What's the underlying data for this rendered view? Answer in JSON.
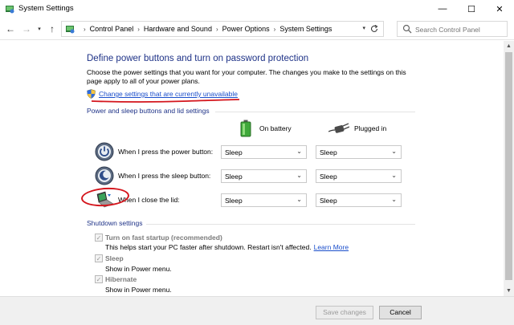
{
  "window": {
    "title": "System Settings",
    "minimize_glyph": "—",
    "maximize_glyph": "☐",
    "close_glyph": "✕"
  },
  "navigation": {
    "back_glyph": "←",
    "forward_glyph": "→",
    "history_glyph": "▾",
    "up_glyph": "↑",
    "breadcrumbs": [
      "Control Panel",
      "Hardware and Sound",
      "Power Options",
      "System Settings"
    ],
    "separator": "›",
    "search_placeholder": "Search Control Panel"
  },
  "main": {
    "heading": "Define power buttons and turn on password protection",
    "description": "Choose the power settings that you want for your computer. The changes you make to the settings on this page apply to all of your power plans.",
    "change_settings_link": "Change settings that are currently unavailable",
    "buttons_section": {
      "label": "Power and sleep buttons and lid settings",
      "on_battery": "On battery",
      "plugged_in": "Plugged in",
      "rows": [
        {
          "label": "When I press the power button:",
          "on_battery": "Sleep",
          "plugged_in": "Sleep",
          "icon": "power-button-icon"
        },
        {
          "label": "When I press the sleep button:",
          "on_battery": "Sleep",
          "plugged_in": "Sleep",
          "icon": "sleep-button-icon"
        },
        {
          "label": "When I close the lid:",
          "on_battery": "Sleep",
          "plugged_in": "Sleep",
          "icon": "laptop-lid-icon"
        }
      ]
    },
    "shutdown_section": {
      "label": "Shutdown settings",
      "options": [
        {
          "label": "Turn on fast startup (recommended)",
          "checked": true,
          "description": "This helps start your PC faster after shutdown. Restart isn't affected.",
          "link": "Learn More"
        },
        {
          "label": "Sleep",
          "checked": true,
          "description": "Show in Power menu."
        },
        {
          "label": "Hibernate",
          "checked": true,
          "description": "Show in Power menu."
        }
      ]
    }
  },
  "footer": {
    "save_label": "Save changes",
    "cancel_label": "Cancel"
  },
  "colors": {
    "heading": "#1e3287",
    "link": "#1a4ecb",
    "annotation": "#d4151c"
  }
}
